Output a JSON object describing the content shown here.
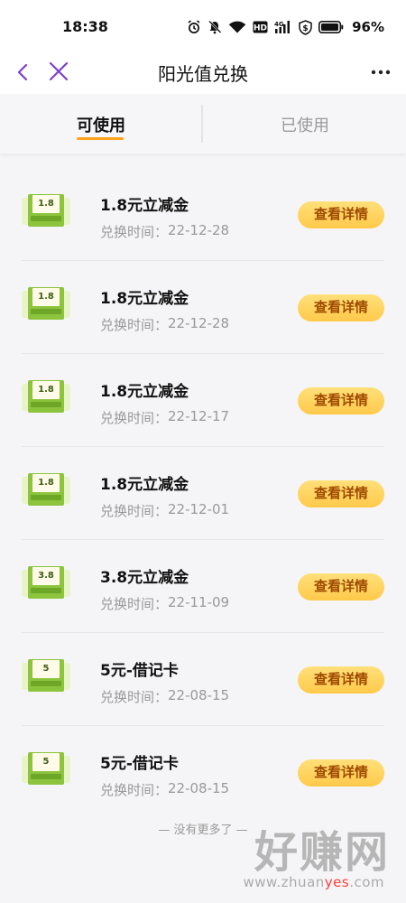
{
  "status_bar": {
    "time": "18:38",
    "battery": "96%",
    "icons": [
      "alarm-icon",
      "mute-icon",
      "wifi-icon",
      "hd-icon",
      "signal-4g-icon",
      "shield-dollar-icon",
      "battery-icon"
    ]
  },
  "nav": {
    "title": "阳光值兑换",
    "back_icon": "chevron-left-icon",
    "close_icon": "close-icon",
    "more_icon": "more-dots-icon"
  },
  "tabs": [
    {
      "label": "可使用",
      "active": true
    },
    {
      "label": "已使用",
      "active": false
    }
  ],
  "items": [
    {
      "title": "1.8元立减金",
      "time_label": "兑换时间：",
      "time": "22-12-28",
      "thumb_value": "1.8",
      "button": "查看详情"
    },
    {
      "title": "1.8元立减金",
      "time_label": "兑换时间：",
      "time": "22-12-28",
      "thumb_value": "1.8",
      "button": "查看详情"
    },
    {
      "title": "1.8元立减金",
      "time_label": "兑换时间：",
      "time": "22-12-17",
      "thumb_value": "1.8",
      "button": "查看详情"
    },
    {
      "title": "1.8元立减金",
      "time_label": "兑换时间：",
      "time": "22-12-01",
      "thumb_value": "1.8",
      "button": "查看详情"
    },
    {
      "title": "3.8元立减金",
      "time_label": "兑换时间：",
      "time": "22-11-09",
      "thumb_value": "3.8",
      "button": "查看详情"
    },
    {
      "title": "5元-借记卡",
      "time_label": "兑换时间：",
      "time": "22-08-15",
      "thumb_value": "5",
      "button": "查看详情"
    },
    {
      "title": "5元-借记卡",
      "time_label": "兑换时间：",
      "time": "22-08-15",
      "thumb_value": "5",
      "button": "查看详情"
    }
  ],
  "footer": {
    "no_more": "— 没有更多了 —"
  },
  "watermark": {
    "big": "好赚网",
    "url_prefix": "www.zhuan",
    "url_accent": "yes",
    "url_suffix": ".com"
  },
  "colors": {
    "nav_icon": "#7b3fd0",
    "tab_underline": "#ffa31a",
    "button_bg": "#ffd45e",
    "button_text": "#a04a00"
  }
}
